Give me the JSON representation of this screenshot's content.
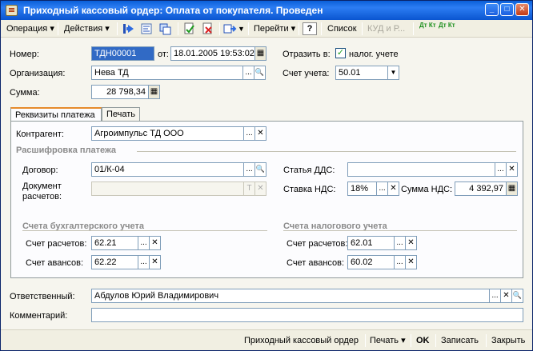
{
  "window": {
    "title": "Приходный кассовый ордер: Оплата от покупателя. Проведен",
    "minimize": "_",
    "maximize": "□",
    "close": "✕"
  },
  "toolbar": {
    "operation": "Операция ▾",
    "actions": "Действия ▾",
    "goto": "Перейти ▾",
    "help": "?",
    "list": "Список",
    "kud": "КУД и Р...",
    "dt_kt": "Дт Кт",
    "dtn_kt": "Дт Кт"
  },
  "header": {
    "number_label": "Номер:",
    "number_value": "ТДН00001",
    "date_label": "от:",
    "date_value": "18.01.2005 19:53:02",
    "reflect_label": "Отразить в:",
    "tax_check_label": "налог. учете",
    "tax_checked": "✓",
    "org_label": "Организация:",
    "org_value": "Нева ТД",
    "account_label": "Счет учета:",
    "account_value": "50.01",
    "sum_label": "Сумма:",
    "sum_value": "28 798,34"
  },
  "tabs": [
    "Реквизиты платежа",
    "Печать"
  ],
  "payment": {
    "counterparty_label": "Контрагент:",
    "counterparty_value": "Агроимпульс ТД ООО",
    "breakdown_title": "Расшифровка платежа",
    "contract_label": "Договор:",
    "contract_value": "01/К-04",
    "settle_doc_label_1": "Документ",
    "settle_doc_label_2": "расчетов:",
    "settle_doc_value": "",
    "dds_label": "Статья ДДС:",
    "dds_value": "",
    "vat_rate_label": "Ставка НДС:",
    "vat_rate_value": "18%",
    "vat_sum_label": "Сумма НДС:",
    "vat_sum_value": "4 392,97",
    "acc_title": "Счета бухгалтерского учета",
    "acc_settle_label": "Счет расчетов:",
    "acc_settle_value": "62.21",
    "acc_adv_label": "Счет авансов:",
    "acc_adv_value": "62.22",
    "tax_title": "Счета налогового учета",
    "tax_settle_label": "Счет расчетов:",
    "tax_settle_value": "62.01",
    "tax_adv_label": "Счет авансов:",
    "tax_adv_value": "60.02"
  },
  "footer": {
    "responsible_label": "Ответственный:",
    "responsible_value": "Абдулов Юрий Владимирович",
    "comment_label": "Комментарий:",
    "comment_value": ""
  },
  "statusbar": {
    "pko": "Приходный кассовый ордер",
    "print": "Печать ▾",
    "ok": "OK",
    "save": "Записать",
    "close": "Закрыть"
  },
  "glyphs": {
    "dots": "...",
    "search": "🔍",
    "clear": "✕",
    "dropdown": "▼",
    "t": "T",
    "calendar": "▦",
    "calc": "▦"
  },
  "colors": {
    "title_bar": "#0a5fd8",
    "selection": "#316ac5",
    "tab_accent": "#e68b2c"
  }
}
